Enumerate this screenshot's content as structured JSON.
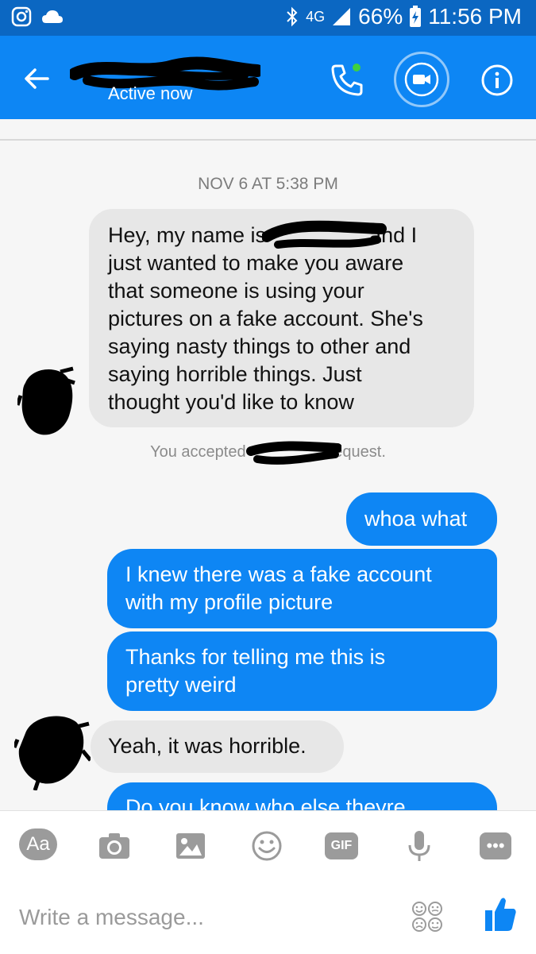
{
  "status_bar": {
    "signal_label": "4G",
    "battery": "66%",
    "time": "11:56 PM"
  },
  "header": {
    "status": "Active now"
  },
  "conversation": {
    "timestamp": "NOV 6 AT 5:38 PM",
    "incoming_1_lines": [
      "Hey, my name is",
      "and I",
      "just wanted to make you aware",
      "that someone is using your",
      "pictures on a fake account. She's",
      "saying nasty things to other and",
      "saying horrible things. Just",
      "thought you'd like to know"
    ],
    "request_note_start": "You accepted",
    "request_note_end": "request.",
    "outgoing_1": "whoa what",
    "outgoing_2_lines": [
      "I knew there was a fake account",
      "with my profile picture"
    ],
    "outgoing_3_lines": [
      "Thanks for telling me this is",
      "pretty weird"
    ],
    "incoming_2": "Yeah, it was horrible.",
    "outgoing_4_partial": "Do you know who else theyre"
  },
  "composer": {
    "aa_label": "Aa",
    "gif_label": "GIF",
    "more_label": "•••",
    "placeholder": "Write a message..."
  },
  "colors": {
    "status_bar": "#0b67c2",
    "app_bar": "#0d86f4",
    "incoming_bubble": "#e7e7e7",
    "outgoing_bubble": "#0e86f4",
    "background": "#f6f6f6"
  },
  "icons": [
    "instagram-icon",
    "cloud-icon",
    "bluetooth-icon",
    "signal-icon",
    "battery-icon",
    "back-arrow-icon",
    "phone-icon",
    "video-icon",
    "info-icon",
    "camera-icon",
    "image-icon",
    "smiley-icon",
    "microphone-icon",
    "stickers-icon",
    "like-icon"
  ]
}
